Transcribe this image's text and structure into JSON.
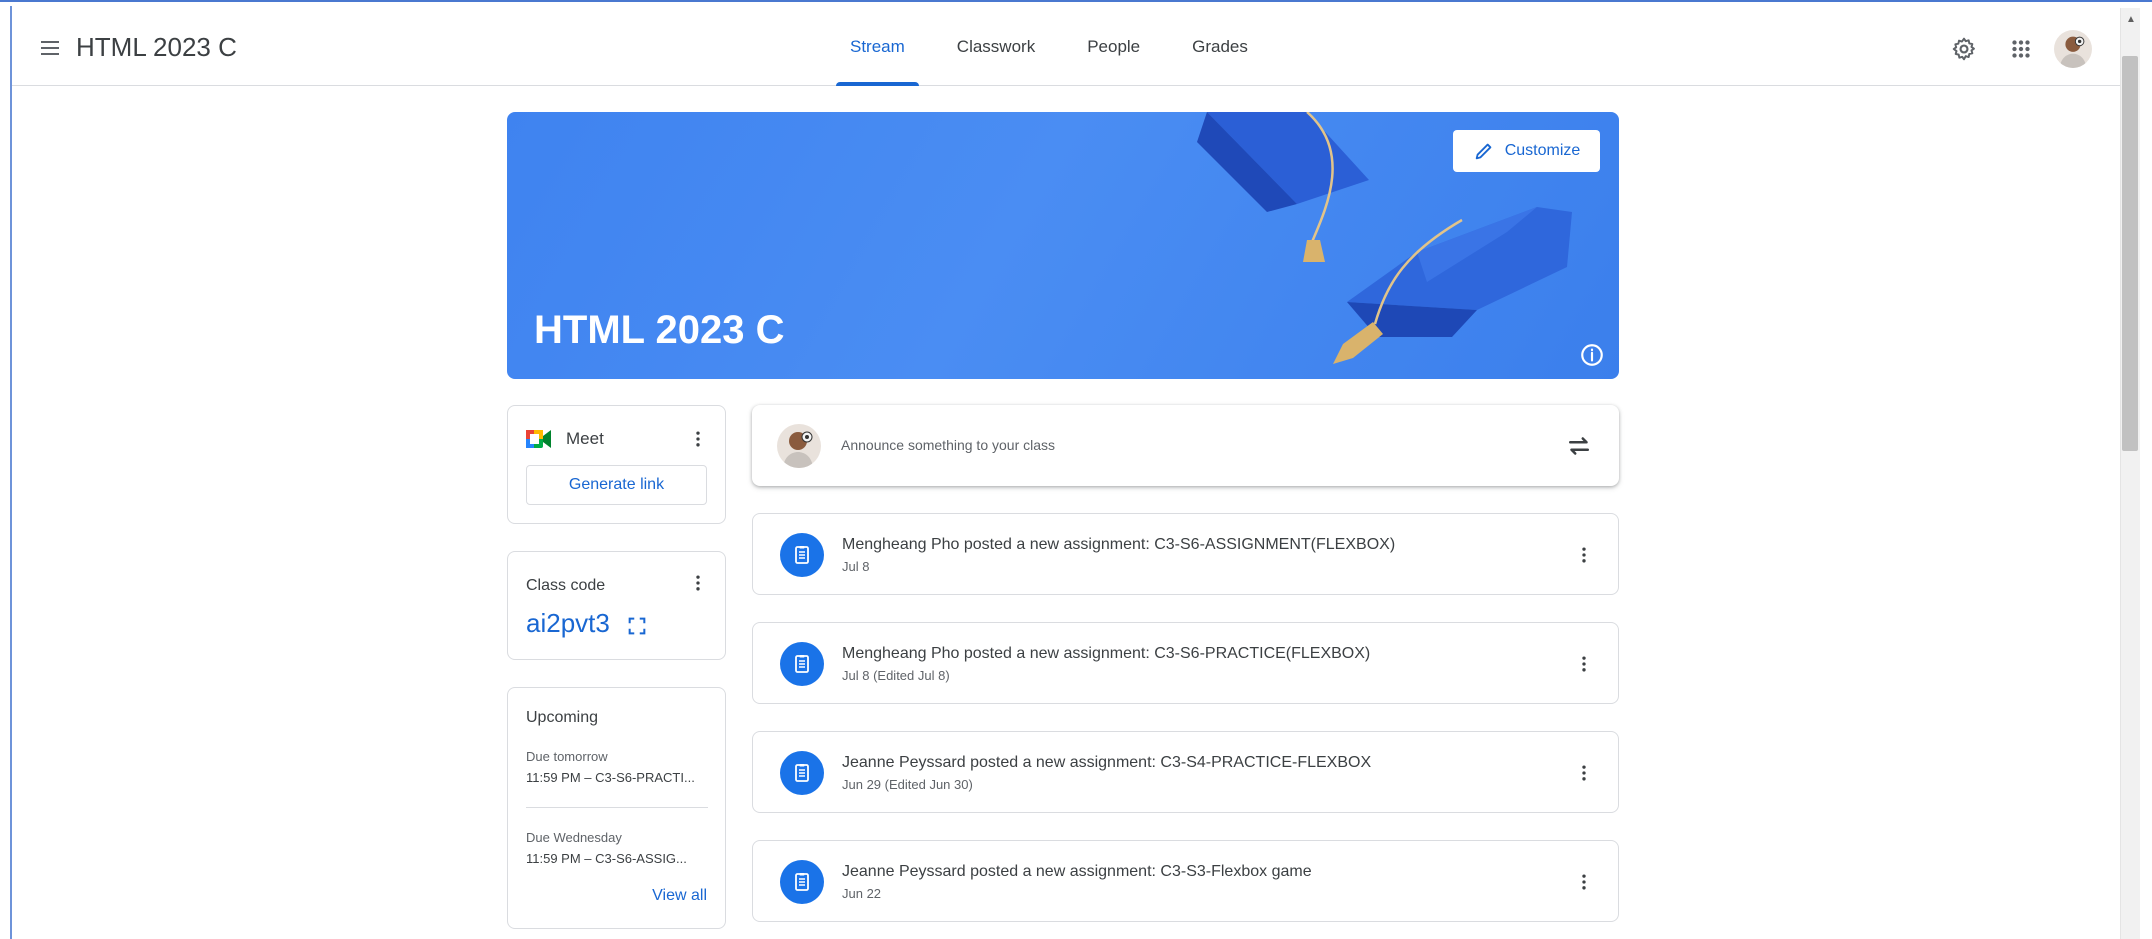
{
  "header": {
    "title": "HTML 2023 C",
    "tabs": [
      {
        "label": "Stream",
        "active": true
      },
      {
        "label": "Classwork",
        "active": false
      },
      {
        "label": "People",
        "active": false
      },
      {
        "label": "Grades",
        "active": false
      }
    ],
    "icons": [
      "menu-icon",
      "settings-icon",
      "apps-icon",
      "avatar"
    ]
  },
  "banner": {
    "title": "HTML 2023 C",
    "customize_label": "Customize",
    "color": "#4285f4"
  },
  "meet": {
    "label": "Meet",
    "generate_link_label": "Generate link"
  },
  "class_code": {
    "label": "Class code",
    "value": "ai2pvt3"
  },
  "upcoming": {
    "title": "Upcoming",
    "items": [
      {
        "due": "Due tomorrow",
        "item": "11:59 PM – C3-S6-PRACTI..."
      },
      {
        "due": "Due Wednesday",
        "item": "11:59 PM – C3-S6-ASSIG..."
      }
    ],
    "view_all_label": "View all"
  },
  "announce": {
    "placeholder": "Announce something to your class"
  },
  "posts": [
    {
      "title": "Mengheang Pho posted a new assignment: C3-S6-ASSIGNMENT(FLEXBOX)",
      "date": "Jul 8"
    },
    {
      "title": "Mengheang Pho posted a new assignment: C3-S6-PRACTICE(FLEXBOX)",
      "date": "Jul 8 (Edited Jul 8)"
    },
    {
      "title": "Jeanne Peyssard posted a new assignment: C3-S4-PRACTICE-FLEXBOX",
      "date": "Jun 29 (Edited Jun 30)"
    },
    {
      "title": "Jeanne Peyssard posted a new assignment: C3-S3-Flexbox game",
      "date": "Jun 22"
    }
  ],
  "colors": {
    "accent": "#1967d2",
    "banner": "#4285f4",
    "assignment_icon": "#1a73e8"
  }
}
